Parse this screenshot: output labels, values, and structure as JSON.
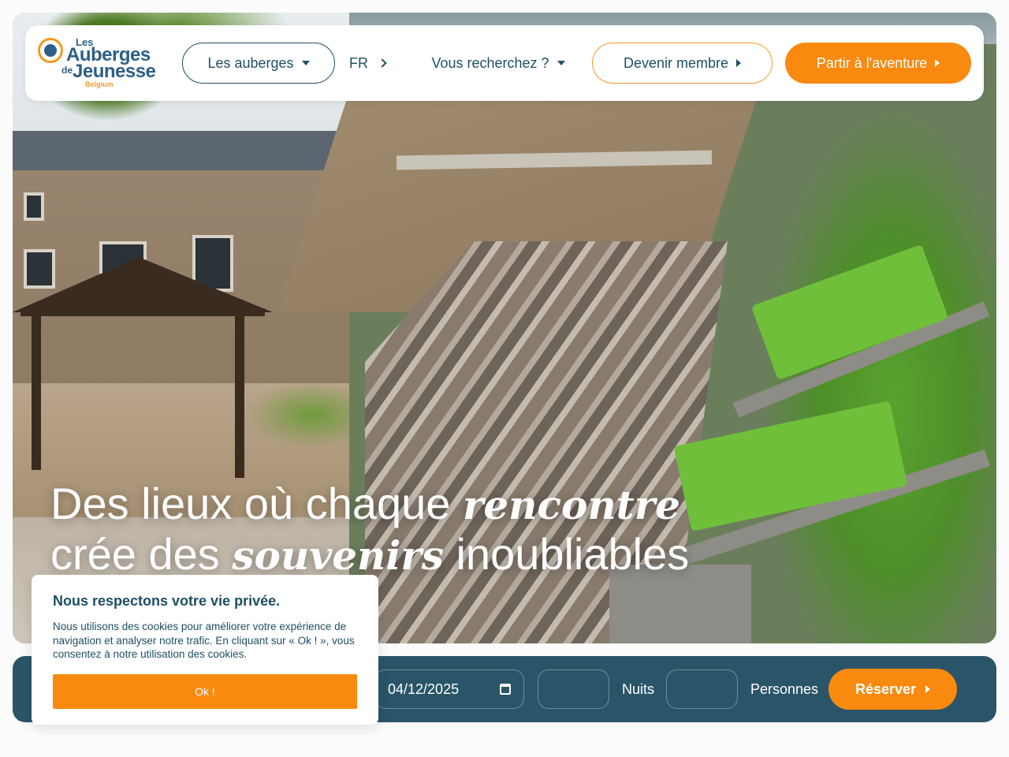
{
  "brand": {
    "logo_les": "Les",
    "logo_auberges": "Auberges",
    "logo_de": "de",
    "logo_jeunesse": "Jeunesse",
    "logo_country": "Belgium",
    "colors": {
      "primary": "#1f4f63",
      "accent": "#f98a0f",
      "accent_outline": "#f39a21",
      "booking_bar": "#2a5568"
    }
  },
  "nav": {
    "auberges_label": "Les auberges",
    "language_label": "FR",
    "search_label": "Vous recherchez ?",
    "member_label": "Devenir membre",
    "adventure_label": "Partir à l'aventure"
  },
  "hero": {
    "line1_a": "Des lieux où chaque ",
    "line1_b": "rencontre",
    "line2_a": "crée des ",
    "line2_b": "souvenirs",
    "line2_c": " inoubliables"
  },
  "booking": {
    "date_value": "04/12/2025",
    "nights_label": "Nuits",
    "persons_label": "Personnes",
    "reserve_label": "Réserver"
  },
  "cookie": {
    "title": "Nous respectons votre vie privée.",
    "text": "Nous utilisons des cookies pour améliorer votre expérience de navigation et analyser notre trafic. En cliquant sur « Ok ! », vous consentez à notre utilisation des cookies.",
    "ok_label": "Ok !"
  },
  "icons": [
    "logo-icon",
    "caret-down-icon",
    "chevron-right-icon",
    "caret-right-icon",
    "calendar-icon"
  ]
}
